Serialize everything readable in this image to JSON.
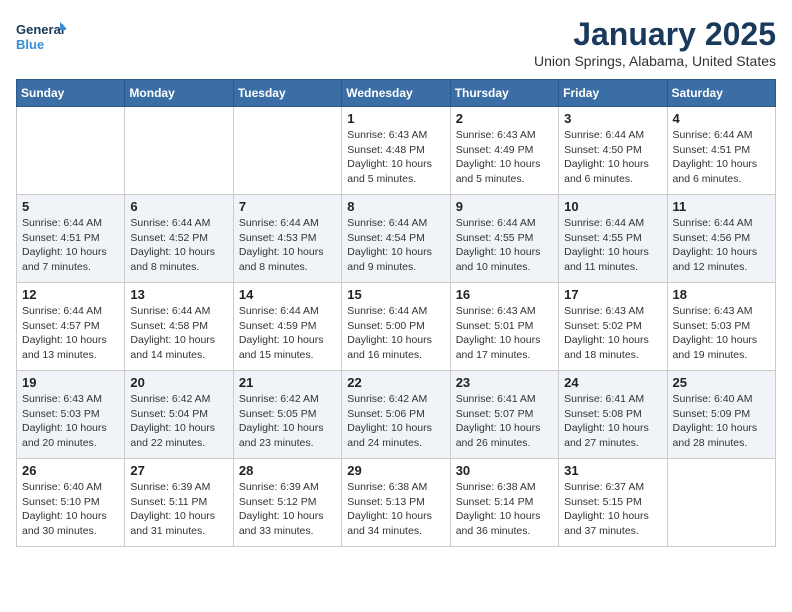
{
  "logo": {
    "text_general": "General",
    "text_blue": "Blue"
  },
  "title": "January 2025",
  "location": "Union Springs, Alabama, United States",
  "weekdays": [
    "Sunday",
    "Monday",
    "Tuesday",
    "Wednesday",
    "Thursday",
    "Friday",
    "Saturday"
  ],
  "weeks": [
    [
      {
        "day": "",
        "info": ""
      },
      {
        "day": "",
        "info": ""
      },
      {
        "day": "",
        "info": ""
      },
      {
        "day": "1",
        "info": "Sunrise: 6:43 AM\nSunset: 4:48 PM\nDaylight: 10 hours\nand 5 minutes."
      },
      {
        "day": "2",
        "info": "Sunrise: 6:43 AM\nSunset: 4:49 PM\nDaylight: 10 hours\nand 5 minutes."
      },
      {
        "day": "3",
        "info": "Sunrise: 6:44 AM\nSunset: 4:50 PM\nDaylight: 10 hours\nand 6 minutes."
      },
      {
        "day": "4",
        "info": "Sunrise: 6:44 AM\nSunset: 4:51 PM\nDaylight: 10 hours\nand 6 minutes."
      }
    ],
    [
      {
        "day": "5",
        "info": "Sunrise: 6:44 AM\nSunset: 4:51 PM\nDaylight: 10 hours\nand 7 minutes."
      },
      {
        "day": "6",
        "info": "Sunrise: 6:44 AM\nSunset: 4:52 PM\nDaylight: 10 hours\nand 8 minutes."
      },
      {
        "day": "7",
        "info": "Sunrise: 6:44 AM\nSunset: 4:53 PM\nDaylight: 10 hours\nand 8 minutes."
      },
      {
        "day": "8",
        "info": "Sunrise: 6:44 AM\nSunset: 4:54 PM\nDaylight: 10 hours\nand 9 minutes."
      },
      {
        "day": "9",
        "info": "Sunrise: 6:44 AM\nSunset: 4:55 PM\nDaylight: 10 hours\nand 10 minutes."
      },
      {
        "day": "10",
        "info": "Sunrise: 6:44 AM\nSunset: 4:55 PM\nDaylight: 10 hours\nand 11 minutes."
      },
      {
        "day": "11",
        "info": "Sunrise: 6:44 AM\nSunset: 4:56 PM\nDaylight: 10 hours\nand 12 minutes."
      }
    ],
    [
      {
        "day": "12",
        "info": "Sunrise: 6:44 AM\nSunset: 4:57 PM\nDaylight: 10 hours\nand 13 minutes."
      },
      {
        "day": "13",
        "info": "Sunrise: 6:44 AM\nSunset: 4:58 PM\nDaylight: 10 hours\nand 14 minutes."
      },
      {
        "day": "14",
        "info": "Sunrise: 6:44 AM\nSunset: 4:59 PM\nDaylight: 10 hours\nand 15 minutes."
      },
      {
        "day": "15",
        "info": "Sunrise: 6:44 AM\nSunset: 5:00 PM\nDaylight: 10 hours\nand 16 minutes."
      },
      {
        "day": "16",
        "info": "Sunrise: 6:43 AM\nSunset: 5:01 PM\nDaylight: 10 hours\nand 17 minutes."
      },
      {
        "day": "17",
        "info": "Sunrise: 6:43 AM\nSunset: 5:02 PM\nDaylight: 10 hours\nand 18 minutes."
      },
      {
        "day": "18",
        "info": "Sunrise: 6:43 AM\nSunset: 5:03 PM\nDaylight: 10 hours\nand 19 minutes."
      }
    ],
    [
      {
        "day": "19",
        "info": "Sunrise: 6:43 AM\nSunset: 5:03 PM\nDaylight: 10 hours\nand 20 minutes."
      },
      {
        "day": "20",
        "info": "Sunrise: 6:42 AM\nSunset: 5:04 PM\nDaylight: 10 hours\nand 22 minutes."
      },
      {
        "day": "21",
        "info": "Sunrise: 6:42 AM\nSunset: 5:05 PM\nDaylight: 10 hours\nand 23 minutes."
      },
      {
        "day": "22",
        "info": "Sunrise: 6:42 AM\nSunset: 5:06 PM\nDaylight: 10 hours\nand 24 minutes."
      },
      {
        "day": "23",
        "info": "Sunrise: 6:41 AM\nSunset: 5:07 PM\nDaylight: 10 hours\nand 26 minutes."
      },
      {
        "day": "24",
        "info": "Sunrise: 6:41 AM\nSunset: 5:08 PM\nDaylight: 10 hours\nand 27 minutes."
      },
      {
        "day": "25",
        "info": "Sunrise: 6:40 AM\nSunset: 5:09 PM\nDaylight: 10 hours\nand 28 minutes."
      }
    ],
    [
      {
        "day": "26",
        "info": "Sunrise: 6:40 AM\nSunset: 5:10 PM\nDaylight: 10 hours\nand 30 minutes."
      },
      {
        "day": "27",
        "info": "Sunrise: 6:39 AM\nSunset: 5:11 PM\nDaylight: 10 hours\nand 31 minutes."
      },
      {
        "day": "28",
        "info": "Sunrise: 6:39 AM\nSunset: 5:12 PM\nDaylight: 10 hours\nand 33 minutes."
      },
      {
        "day": "29",
        "info": "Sunrise: 6:38 AM\nSunset: 5:13 PM\nDaylight: 10 hours\nand 34 minutes."
      },
      {
        "day": "30",
        "info": "Sunrise: 6:38 AM\nSunset: 5:14 PM\nDaylight: 10 hours\nand 36 minutes."
      },
      {
        "day": "31",
        "info": "Sunrise: 6:37 AM\nSunset: 5:15 PM\nDaylight: 10 hours\nand 37 minutes."
      },
      {
        "day": "",
        "info": ""
      }
    ]
  ]
}
